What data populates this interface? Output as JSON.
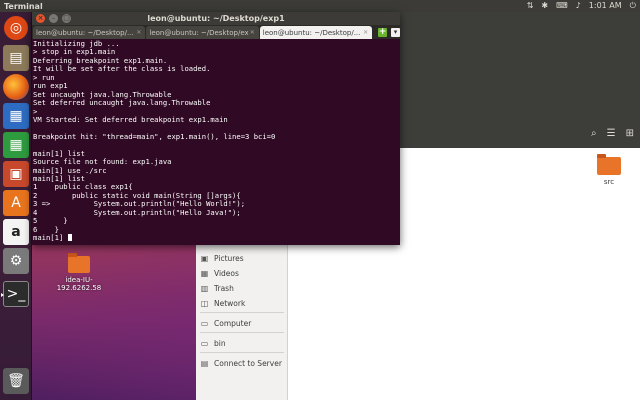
{
  "top_panel": {
    "title": "Terminal",
    "time": "1:01 AM",
    "icons": [
      "network-icon",
      "bluetooth-icon",
      "input-method-icon",
      "volume-icon",
      "power-icon"
    ]
  },
  "launcher": {
    "items": [
      "ubuntu-dash-icon",
      "files-icon",
      "firefox-icon",
      "libreoffice-writer-icon",
      "libreoffice-calc-icon",
      "libreoffice-impress-icon",
      "software-center-icon",
      "amazon-icon",
      "system-settings-icon",
      "terminal-icon",
      "trash-icon"
    ]
  },
  "desktop": {
    "icon_label": "idea-IU-192.6262.58"
  },
  "file_manager": {
    "folder_label": "src",
    "sidebar": [
      "Pictures",
      "Videos",
      "Trash",
      "Network",
      "Computer",
      "bin",
      "Connect to Server"
    ]
  },
  "terminal": {
    "title": "leon@ubuntu: ~/Desktop/exp1",
    "tabs": [
      {
        "label": "leon@ubuntu: ~/Desktop/..."
      },
      {
        "label": "leon@ubuntu: ~/Desktop/exp..."
      },
      {
        "label": "leon@ubuntu: ~/Desktop/..."
      }
    ],
    "lines": [
      "Initializing jdb ...",
      "> stop in exp1.main",
      "Deferring breakpoint exp1.main.",
      "It will be set after the class is loaded.",
      "> run",
      "run exp1",
      "Set uncaught java.lang.Throwable",
      "Set deferred uncaught java.lang.Throwable",
      ">",
      "VM Started: Set deferred breakpoint exp1.main",
      "",
      "Breakpoint hit: \"thread=main\", exp1.main(), line=3 bci=0",
      "",
      "main[1] list",
      "Source file not found: exp1.java",
      "main[1] use ./src",
      "main[1] list",
      "1    public class exp1{",
      "2        public static void main(String []args){",
      "3 =>          System.out.println(\"Hello World!\");",
      "4             System.out.println(\"Hello Java!\");",
      "5      }",
      "6    }",
      "main[1] "
    ]
  },
  "colors": {
    "terminal_bg": "#300a24",
    "panel_bg": "#3c3b37",
    "accent": "#e9542a"
  }
}
